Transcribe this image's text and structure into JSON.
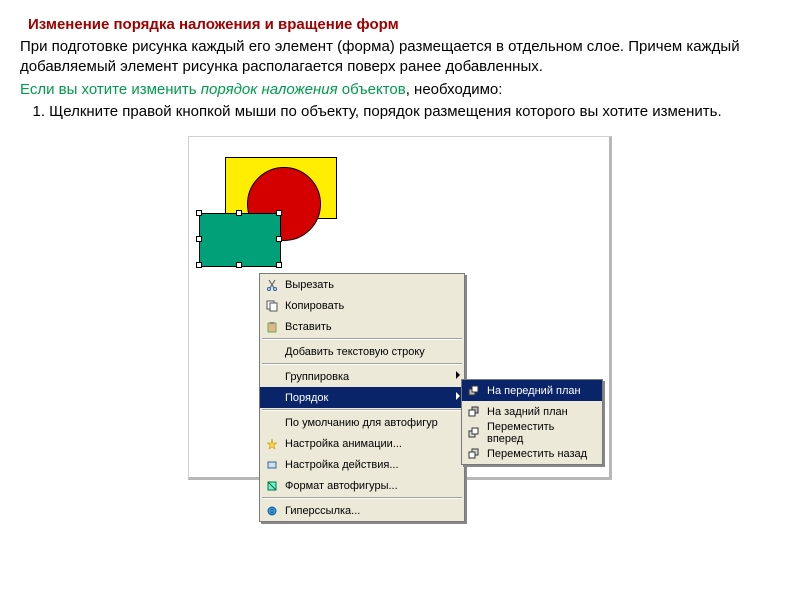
{
  "title": "Изменение порядка наложения и вращение форм",
  "p1": "При подготовке рисунка каждый его элемент (форма) размещается в отдельном слое. Причем каждый добавляемый элемент рисунка располагается поверх ранее добавленных.",
  "p2a": "Если вы хотите изменить ",
  "p2b": "порядок наложения",
  "p2c": " объектов",
  "p2d": ", необходимо:",
  "p3": "   1. Щелкните правой кнопкой мыши по объекту, порядок размещения которого вы хотите изменить.",
  "menu": {
    "cut": "Вырезать",
    "copy": "Копировать",
    "paste": "Вставить",
    "addText": "Добавить текстовую строку",
    "group": "Группировка",
    "order": "Порядок",
    "defaultAuto": "По умолчанию для автофигур",
    "animSettings": "Настройка анимации...",
    "actionSettings": "Настройка действия...",
    "formatAuto": "Формат автофигуры...",
    "hyperlink": "Гиперссылка..."
  },
  "submenu": {
    "front": "На передний план",
    "back": "На задний план",
    "forward": "Переместить вперед",
    "backward": "Переместить назад"
  }
}
